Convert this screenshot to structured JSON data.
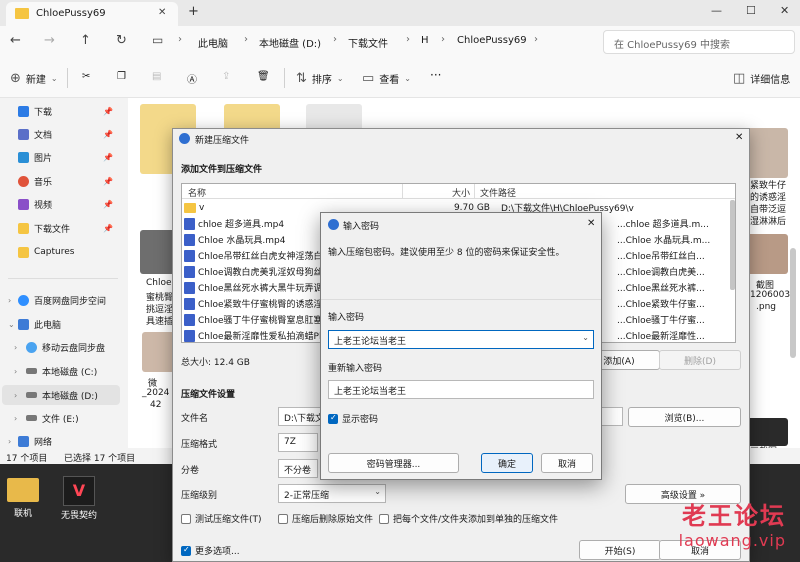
{
  "explorer": {
    "tab_title": "ChloePussy69",
    "breadcrumb": [
      "此电脑",
      "本地磁盘 (D:)",
      "下载文件",
      "H",
      "ChloePussy69"
    ],
    "search_placeholder": "在 ChloePussy69 中搜索",
    "toolbar": {
      "new": "新建",
      "sort": "排序",
      "view": "查看",
      "more": "···",
      "details": "详细信息"
    },
    "sidebar": [
      {
        "label": "下载",
        "color": "#2c7be5",
        "pinned": true
      },
      {
        "label": "文档",
        "color": "#5b6fc8",
        "pinned": true
      },
      {
        "label": "图片",
        "color": "#2a8fd6",
        "pinned": true
      },
      {
        "label": "音乐",
        "color": "#e0533a",
        "pinned": true
      },
      {
        "label": "视频",
        "color": "#8a4fc8",
        "pinned": true
      },
      {
        "label": "下载文件",
        "color": "#f5c542",
        "pinned": true
      },
      {
        "label": "Captures",
        "color": "#f5c542",
        "pinned": false
      }
    ],
    "tree": [
      "百度网盘同步空间",
      "此电脑",
      "移动云盘同步盘",
      "本地磁盘 (C:)",
      "本地磁盘 (D:)",
      "文件 (E:)",
      "网络"
    ],
    "status": {
      "count": "17 个项目",
      "selected": "已选择 17 个项目"
    },
    "content_labels": [
      "Chloe",
      "蜜桃臀",
      "挑逗淫",
      "具速插",
      "紧致牛仔",
      "的诱惑淫",
      "自带泛逗",
      "湿淋淋后",
      "截图",
      "12060030",
      ".png",
      "微",
      "_2024",
      "42",
      "画截图"
    ]
  },
  "desktop": {
    "icons": [
      "联机",
      "无畏契约"
    ]
  },
  "compress_dialog": {
    "title": "新建压缩文件",
    "add_section": "添加文件到压缩文件",
    "columns": {
      "name": "名称",
      "size": "大小",
      "path": "文件路径"
    },
    "files": [
      {
        "name": "v",
        "size": "9.70 GB",
        "path": "D:\\下载文件\\H\\ChloePussy69\\v",
        "type": "folder"
      },
      {
        "name": "chloe 超多道具.mp4",
        "size": "",
        "path": "...chloe 超多道具.m...",
        "type": "mp4"
      },
      {
        "name": "Chloe 水晶玩具.mp4",
        "size": "",
        "path": "...Chloe 水晶玩具.m...",
        "type": "mp4"
      },
      {
        "name": "Chloe吊带红丝白虎女神淫荡白",
        "size": "",
        "path": "...Chloe吊带红丝白...",
        "type": "mp4"
      },
      {
        "name": "Chloe调教白虎美乳淫奴母狗丝",
        "size": "",
        "path": "...Chloe调教白虎美...",
        "type": "mp4"
      },
      {
        "name": "Chloe黑丝死水裤大黑牛玩弄调",
        "size": "",
        "path": "...Chloe黑丝死水裤...",
        "type": "mp4"
      },
      {
        "name": "Chloe紧致牛仔蜜桃臀的诱惑淫",
        "size": "",
        "path": "...Chloe紧致牛仔蜜...",
        "type": "mp4"
      },
      {
        "name": "Chloe骚丁牛仔蜜桃臀窒息肛塞",
        "size": "",
        "path": "...Chloe骚丁牛仔蜜...",
        "type": "mp4"
      },
      {
        "name": "Chloe最新淫靡性爱私拍滴蜡Pla",
        "size": "",
        "path": "...Chloe最新淫靡性...",
        "type": "mp4"
      }
    ],
    "total_size": "总大小: 12.4 GB",
    "add_btn": "添加(A)",
    "delete_btn": "删除(D)",
    "settings_section": "压缩文件设置",
    "filename_label": "文件名",
    "filename_value": "D:\\下载文",
    "format_label": "压缩格式",
    "format_value": "7Z",
    "split_label": "分卷",
    "split_value": "不分卷",
    "level_label": "压缩级别",
    "level_value": "2-正常压缩",
    "browse_btn": "浏览(B)...",
    "advanced_btn": "高级设置 »",
    "checkboxes": [
      "测试压缩文件(T)",
      "压缩后删除原始文件",
      "把每个文件/文件夹添加到单独的压缩文件"
    ],
    "more_options": "更多选项...",
    "start_btn": "开始(S)",
    "cancel_btn": "取消"
  },
  "password_dialog": {
    "title": "输入密码",
    "description": "输入压缩包密码。建议使用至少 8 位的密码来保证安全性。",
    "password_label": "输入密码",
    "password_value": "上老王论坛当老王",
    "reenter_label": "重新输入密码",
    "reenter_value": "上老王论坛当老王",
    "show_password": "显示密码",
    "manager_btn": "密码管理器...",
    "ok_btn": "确定",
    "cancel_btn": "取消"
  },
  "watermark": {
    "cn": "老王论坛",
    "url": "laowang.vip"
  }
}
